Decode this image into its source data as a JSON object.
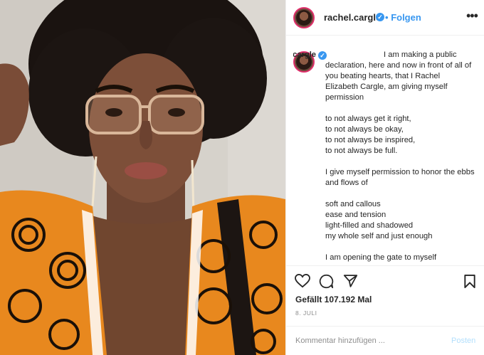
{
  "header": {
    "username": "rachel.cargle",
    "separator": "•",
    "follow_label": "Folgen",
    "more_label": "•••"
  },
  "caption": {
    "username": "rachel.cargle",
    "paragraphs": [
      "I am making a public declaration, here and now in front of all of you beating hearts, that I Rachel Elizabeth Cargle, am giving myself permission",
      "to not always get it right,",
      "to not always be okay,",
      "to not always be inspired,",
      "to not always be full.",
      "I give myself permission to honor the ebbs and flows of",
      "soft and callous",
      "ease and tension",
      "light-filled and shadowed",
      "my whole self and just enough",
      "I am opening the gate to myself"
    ]
  },
  "actions": {
    "like_icon": "heart-icon",
    "comment_icon": "comment-icon",
    "share_icon": "share-icon",
    "save_icon": "bookmark-icon",
    "likes_text": "Gefällt 107.192 Mal",
    "date_text": "8. JULI"
  },
  "comment": {
    "placeholder": "Kommentar hinzufügen ...",
    "post_label": "Posten"
  },
  "colors": {
    "accent": "#3897f0",
    "text": "#262626",
    "muted": "#8e8e8e",
    "post_disabled": "#b2dffc",
    "shirt_orange": "#e8881e"
  }
}
